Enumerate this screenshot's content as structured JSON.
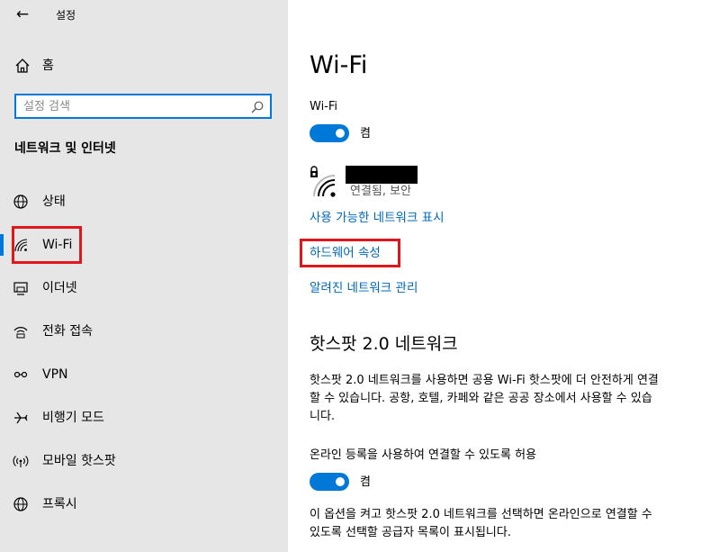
{
  "app": {
    "title": "설정",
    "back_icon": "back-arrow-icon"
  },
  "sidebar": {
    "home_label": "홈",
    "search": {
      "placeholder": "설정 검색",
      "value": ""
    },
    "section_heading": "네트워크 및 인터넷",
    "items": [
      {
        "label": "상태",
        "icon": "status-globe-icon",
        "active": false
      },
      {
        "label": "Wi-Fi",
        "icon": "wifi-icon",
        "active": true
      },
      {
        "label": "이더넷",
        "icon": "ethernet-icon",
        "active": false
      },
      {
        "label": "전화 접속",
        "icon": "dialup-icon",
        "active": false
      },
      {
        "label": "VPN",
        "icon": "vpn-icon",
        "active": false
      },
      {
        "label": "비행기 모드",
        "icon": "airplane-icon",
        "active": false
      },
      {
        "label": "모바일 핫스팟",
        "icon": "hotspot-icon",
        "active": false
      },
      {
        "label": "프록시",
        "icon": "proxy-globe-icon",
        "active": false
      }
    ]
  },
  "main": {
    "title": "Wi-Fi",
    "wifi_label": "Wi-Fi",
    "wifi_toggle_state": "켬",
    "network": {
      "status": "연결됨, 보안"
    },
    "links": {
      "show_available": "사용 가능한 네트워크 표시",
      "hardware_properties": "하드웨어 속성",
      "manage_known": "알려진 네트워크 관리"
    },
    "hotspot_heading": "핫스팟 2.0 네트워크",
    "hotspot_desc_lines": [
      "핫스팟 2.0 네트워크를 사용하면 공용 Wi-Fi 핫스팟에 더 안전하게 연결",
      "할 수 있습니다. 공항, 호텔, 카페와 같은 공공 장소에서 사용할 수 있습",
      "니다."
    ],
    "online_signup_label": "온라인 등록을 사용하여 연결할 수 있도록 허용",
    "online_signup_toggle_state": "켬",
    "option_desc_lines": [
      "이 옵션을 켜고 핫스팟 2.0 네트워크를 선택하면 온라인으로 연결할 수",
      "있도록 선택할 공급자 목록이 표시됩니다."
    ]
  },
  "colors": {
    "accent": "#0078d7",
    "link": "#0067b8",
    "highlight": "#e0161d",
    "sidebar_bg": "#e6e6e6"
  }
}
